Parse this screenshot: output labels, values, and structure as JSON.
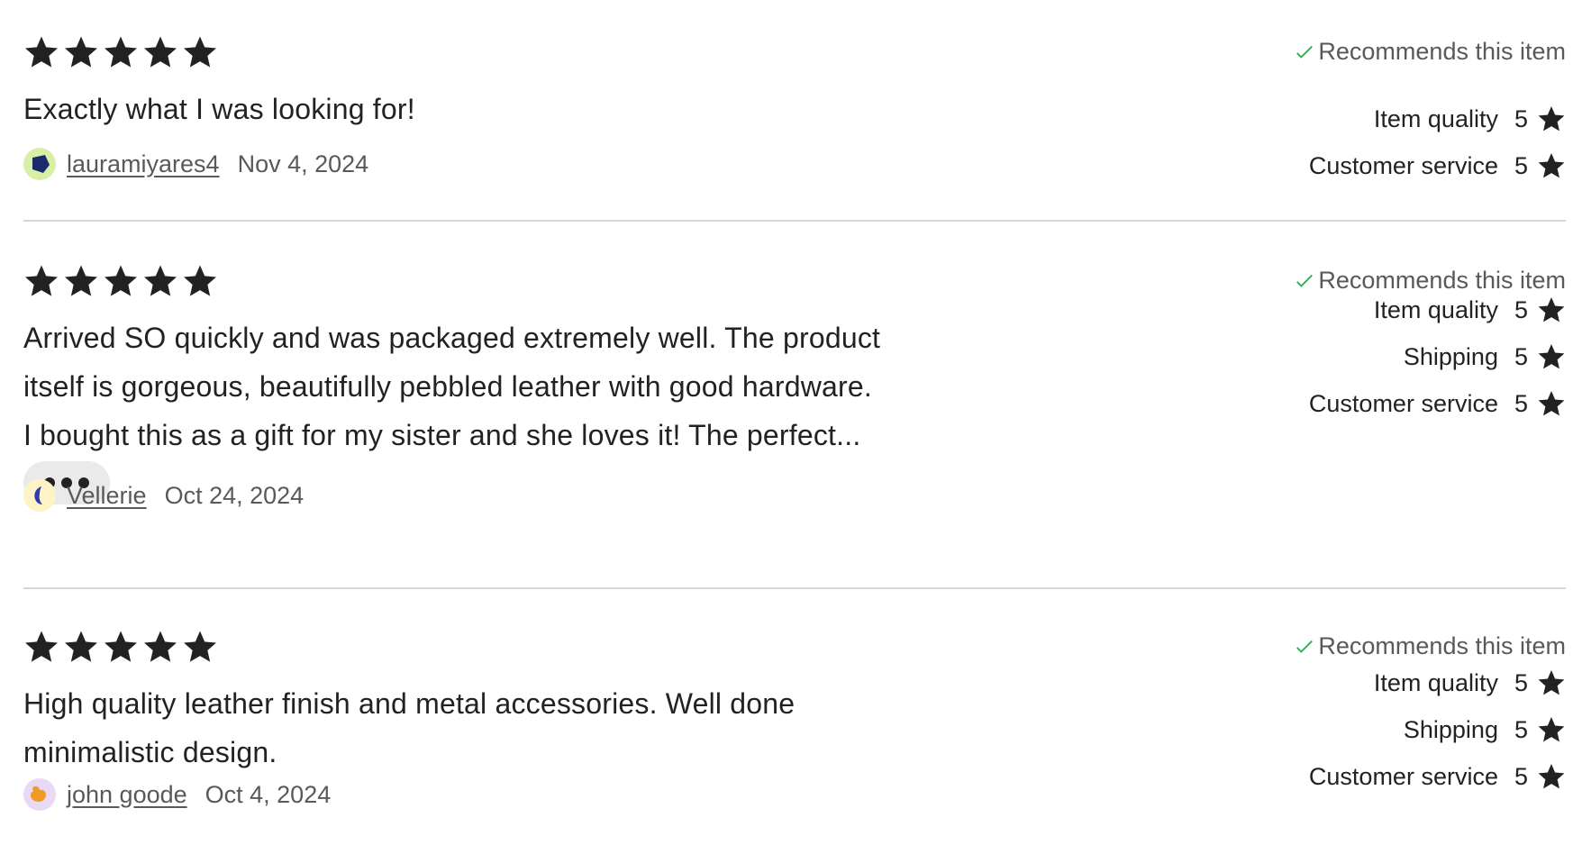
{
  "reviews": [
    {
      "stars": 5,
      "recommends": "Recommends this item",
      "text": "Exactly what I was looking for!",
      "reviewer": "lauramiyares4",
      "date": "Nov 4, 2024",
      "avatar_bg": "#d7f0a6",
      "avatar_fg": "#1b2a6b",
      "ratings": [
        {
          "label": "Item quality",
          "value": "5"
        },
        {
          "label": "Customer service",
          "value": "5"
        }
      ]
    },
    {
      "stars": 5,
      "recommends": "Recommends this item",
      "text_lines": [
        "Arrived SO quickly and was packaged extremely well. The product",
        "itself is gorgeous, beautifully pebbled leather with good hardware.",
        "I bought this as a gift for my sister and she loves it! The perfect..."
      ],
      "more_icon": "ellipsis-icon",
      "reviewer": "Vellerie",
      "date": "Oct 24, 2024",
      "avatar_bg": "#fdf3c4",
      "avatar_fg": "#2a3bb5",
      "ratings": [
        {
          "label": "Item quality",
          "value": "5"
        },
        {
          "label": "Shipping",
          "value": "5"
        },
        {
          "label": "Customer service",
          "value": "5"
        }
      ]
    },
    {
      "stars": 5,
      "recommends": "Recommends this item",
      "text_lines": [
        "High quality leather finish and metal accessories. Well done",
        "minimalistic design."
      ],
      "reviewer": "john goode",
      "date": "Oct 4, 2024",
      "avatar_bg": "#ead9f5",
      "avatar_fg": "#f29a26",
      "ratings": [
        {
          "label": "Item quality",
          "value": "5"
        },
        {
          "label": "Shipping",
          "value": "5"
        },
        {
          "label": "Customer service",
          "value": "5"
        }
      ]
    }
  ],
  "colors": {
    "star": "#222222",
    "check": "#2eab50",
    "divider": "#d6d6d6",
    "muted_text": "#595959"
  }
}
